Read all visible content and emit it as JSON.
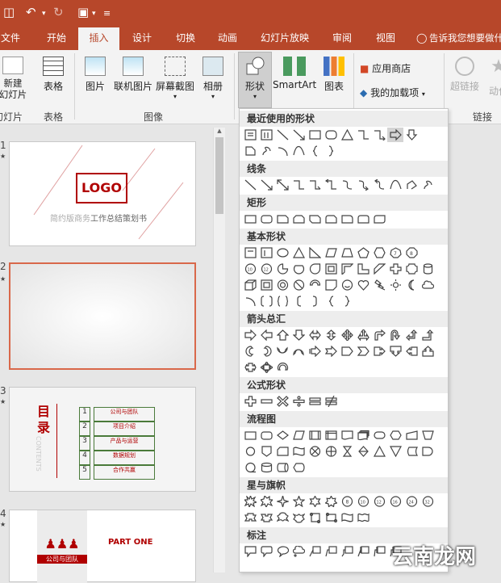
{
  "tabs": [
    "文件",
    "开始",
    "插入",
    "设计",
    "切换",
    "动画",
    "幻灯片放映",
    "审阅",
    "视图",
    "告诉我您想要做什么"
  ],
  "ribbon": {
    "new_slide": "新建\n幻灯片",
    "table": "表格",
    "picture": "图片",
    "online_picture": "联机图片",
    "screenshot": "屏幕截图",
    "album": "相册",
    "shapes": "形状",
    "smartart": "SmartArt",
    "chart": "图表",
    "app_store": "应用商店",
    "my_addins": "我的加载项",
    "hyperlink": "超链接",
    "action": "动作",
    "group_slides": "幻灯片",
    "group_tables": "表格",
    "group_images": "图像",
    "group_links": "链接"
  },
  "slides": [
    {
      "num": "1",
      "logo": "LOGO",
      "title_left": "简约版商务",
      "title_right": "工作总结策划书"
    },
    {
      "num": "2"
    },
    {
      "num": "3",
      "title": "目录",
      "sub": "CONTENTS",
      "items": [
        "公司与团队",
        "项目介绍",
        "产品与运营",
        "数据规划",
        "合作共赢"
      ],
      "nums": [
        "1",
        "2",
        "3",
        "4",
        "5"
      ]
    },
    {
      "num": "4",
      "heading": "PART ONE",
      "subtitle": "公司与团队"
    }
  ],
  "gallery": {
    "sections": [
      "最近使用的形状",
      "线条",
      "矩形",
      "基本形状",
      "箭头总汇",
      "公式形状",
      "流程图",
      "星与旗帜",
      "标注"
    ]
  },
  "watermark": "云南龙网",
  "colors": {
    "accent": "#b7472a",
    "selected_border": "#d9684a",
    "logo_red": "#b00000"
  }
}
